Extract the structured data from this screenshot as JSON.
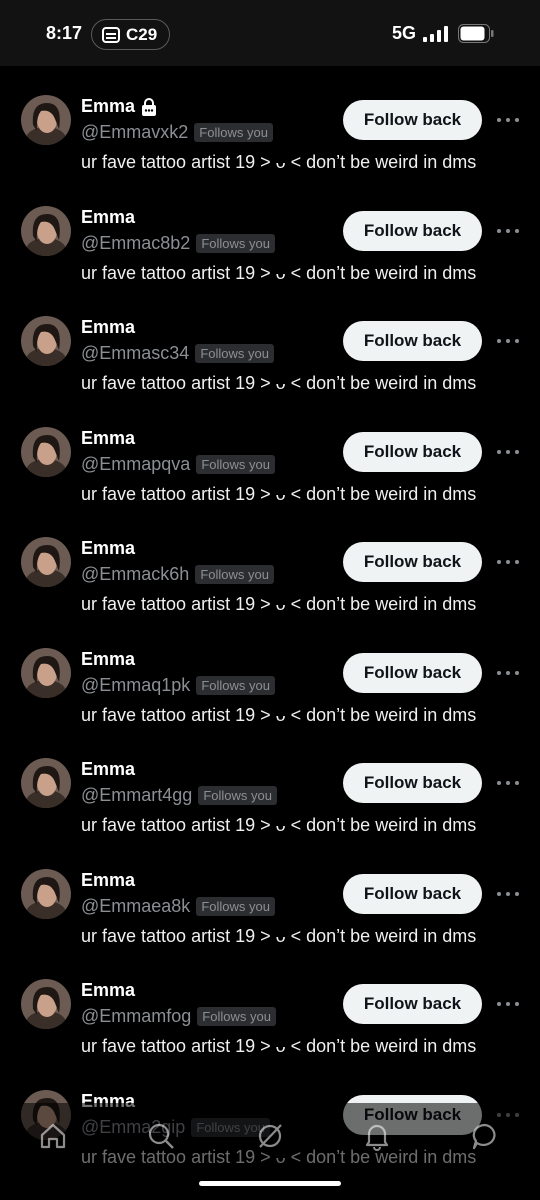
{
  "status_bar": {
    "time": "8:17",
    "carrier_label": "C29",
    "network": "5G"
  },
  "colors": {
    "background": "#000000",
    "secondary_text": "#8b8f94",
    "button_bg": "#eff3f4",
    "button_text": "#0f1419"
  },
  "followers": [
    {
      "name": "Emma",
      "protected": true,
      "handle": "@Emmavxk2",
      "badge": "Follows you",
      "bio": "ur fave tattoo artist 19 ˃ ᴗ ˂ don’t be weird in dms",
      "button": "Follow back"
    },
    {
      "name": "Emma",
      "protected": false,
      "handle": "@Emmac8b2",
      "badge": "Follows you",
      "bio": "ur fave tattoo artist 19 ˃ ᴗ ˂ don’t be weird in dms",
      "button": "Follow back"
    },
    {
      "name": "Emma",
      "protected": false,
      "handle": "@Emmasc34",
      "badge": "Follows you",
      "bio": "ur fave tattoo artist 19 ˃ ᴗ ˂ don’t be weird in dms",
      "button": "Follow back"
    },
    {
      "name": "Emma",
      "protected": false,
      "handle": "@Emmapqva",
      "badge": "Follows you",
      "bio": "ur fave tattoo artist 19 ˃ ᴗ ˂ don’t be weird in dms",
      "button": "Follow back"
    },
    {
      "name": "Emma",
      "protected": false,
      "handle": "@Emmack6h",
      "badge": "Follows you",
      "bio": "ur fave tattoo artist 19 ˃ ᴗ ˂ don’t be weird in dms",
      "button": "Follow back"
    },
    {
      "name": "Emma",
      "protected": false,
      "handle": "@Emmaq1pk",
      "badge": "Follows you",
      "bio": "ur fave tattoo artist 19 ˃ ᴗ ˂ don’t be weird in dms",
      "button": "Follow back"
    },
    {
      "name": "Emma",
      "protected": false,
      "handle": "@Emmart4gg",
      "badge": "Follows you",
      "bio": "ur fave tattoo artist 19 ˃ ᴗ ˂ don’t be weird in dms",
      "button": "Follow back"
    },
    {
      "name": "Emma",
      "protected": false,
      "handle": "@Emmaea8k",
      "badge": "Follows you",
      "bio": "ur fave tattoo artist 19 ˃ ᴗ ˂ don’t be weird in dms",
      "button": "Follow back"
    },
    {
      "name": "Emma",
      "protected": false,
      "handle": "@Emmamfog",
      "badge": "Follows you",
      "bio": "ur fave tattoo artist 19 ˃ ᴗ ˂ don’t be weird in dms",
      "button": "Follow back"
    },
    {
      "name": "Emma",
      "protected": false,
      "handle": "@Emma2gip",
      "badge": "Follows you",
      "bio": "ur fave tattoo artist 19 ˃ ᴗ ˂ don’t be weird in dms",
      "button": "Follow back"
    }
  ],
  "bottom_nav": [
    {
      "icon": "home-icon"
    },
    {
      "icon": "search-icon"
    },
    {
      "icon": "grok-icon"
    },
    {
      "icon": "bell-icon"
    },
    {
      "icon": "chat-icon"
    }
  ]
}
